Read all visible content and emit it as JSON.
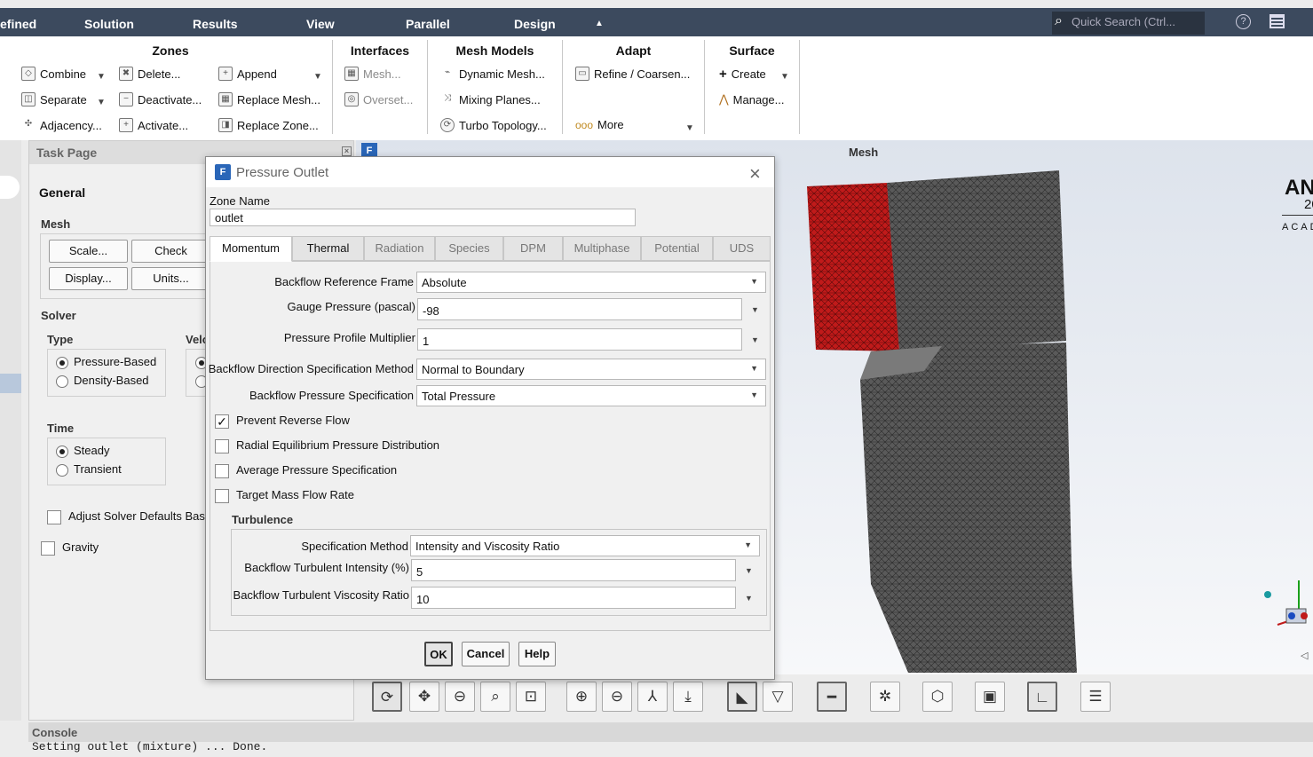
{
  "menubar": {
    "items": [
      "efined",
      "Solution",
      "Results",
      "View",
      "Parallel",
      "Design"
    ],
    "search_placeholder": "Quick Search (Ctrl..."
  },
  "ribbon": {
    "zones": {
      "title": "Zones",
      "combine": "Combine",
      "separate": "Separate",
      "adjacency": "Adjacency...",
      "delete": "Delete...",
      "deactivate": "Deactivate...",
      "activate": "Activate...",
      "append": "Append",
      "replace_mesh": "Replace Mesh...",
      "replace_zone": "Replace Zone..."
    },
    "interfaces": {
      "title": "Interfaces",
      "mesh": "Mesh...",
      "overset": "Overset..."
    },
    "mesh_models": {
      "title": "Mesh Models",
      "dynamic": "Dynamic Mesh...",
      "mixing": "Mixing Planes...",
      "turbo": "Turbo Topology..."
    },
    "adapt": {
      "title": "Adapt",
      "refine": "Refine / Coarsen...",
      "more": "More"
    },
    "surface": {
      "title": "Surface",
      "create": "Create",
      "manage": "Manage..."
    }
  },
  "task_page": {
    "header": "Task Page",
    "general": "General",
    "mesh_label": "Mesh",
    "scale": "Scale...",
    "check": "Check",
    "display": "Display...",
    "units": "Units...",
    "solver_label": "Solver",
    "type_label": "Type",
    "velocity_label": "Velo",
    "pressure_based": "Pressure-Based",
    "density_based": "Density-Based",
    "time_label": "Time",
    "steady": "Steady",
    "transient": "Transient",
    "adjust": "Adjust Solver Defaults Base",
    "gravity": "Gravity"
  },
  "viewport": {
    "title": "Mesh",
    "brand": "AN",
    "brand_line2": "20",
    "brand_line3": "ACAD"
  },
  "console": {
    "header": "Console",
    "text": "Setting outlet (mixture) ... Done."
  },
  "dialog": {
    "title": "Pressure Outlet",
    "logo": "F",
    "zone_name_label": "Zone Name",
    "zone_name": "outlet",
    "tabs": [
      "Momentum",
      "Thermal",
      "Radiation",
      "Species",
      "DPM",
      "Multiphase",
      "Potential",
      "UDS"
    ],
    "backflow_ref_frame_label": "Backflow Reference Frame",
    "backflow_ref_frame": "Absolute",
    "gauge_pressure_label": "Gauge Pressure (pascal)",
    "gauge_pressure": "-98",
    "pressure_profile_label": "Pressure Profile Multiplier",
    "pressure_profile": "1",
    "backflow_dir_label": "Backflow Direction Specification Method",
    "backflow_dir": "Normal to Boundary",
    "backflow_pressure_label": "Backflow Pressure Specification",
    "backflow_pressure": "Total Pressure",
    "prevent_reverse": "Prevent Reverse Flow",
    "radial_eq": "Radial Equilibrium Pressure Distribution",
    "avg_pressure": "Average Pressure Specification",
    "target_mass": "Target Mass Flow Rate",
    "turbulence_label": "Turbulence",
    "spec_method_label": "Specification Method",
    "spec_method": "Intensity and Viscosity Ratio",
    "intensity_label": "Backflow Turbulent Intensity (%)",
    "intensity": "5",
    "viscosity_label": "Backflow Turbulent Viscosity Ratio",
    "viscosity": "10",
    "ok": "OK",
    "cancel": "Cancel",
    "help": "Help"
  }
}
